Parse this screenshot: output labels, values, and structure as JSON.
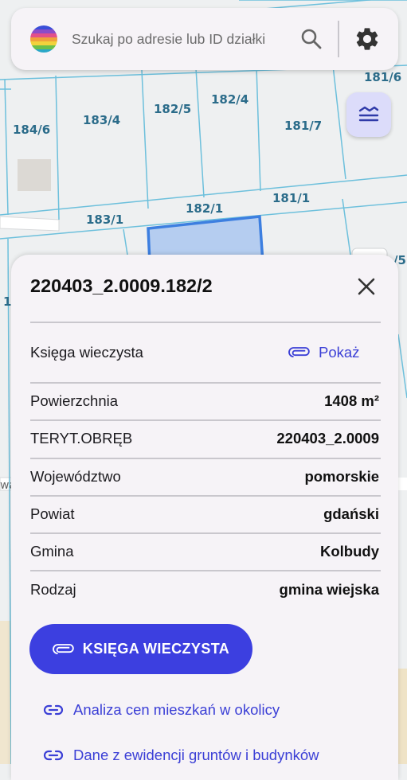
{
  "search": {
    "placeholder": "Szukaj po adresie lub ID działki"
  },
  "map": {
    "parcel_labels": [
      "181/6",
      "184/6",
      "183/4",
      "182/5",
      "182/4",
      "181/7",
      "183/1",
      "182/1",
      "181/1",
      "/5",
      "1",
      "wa"
    ],
    "highlight_color": "#3d7fe0",
    "parcel_line_color": "#6dc0dc"
  },
  "panel": {
    "title": "220403_2.0009.182/2",
    "land_register": {
      "label": "Księga wieczysta",
      "link": "Pokaż"
    },
    "rows": [
      {
        "label": "Powierzchnia",
        "value": "1408 m²"
      },
      {
        "label": "TERYT.OBRĘB",
        "value": "220403_2.0009"
      },
      {
        "label": "Województwo",
        "value": "pomorskie"
      },
      {
        "label": "Powiat",
        "value": "gdański"
      },
      {
        "label": "Gmina",
        "value": "Kolbudy"
      },
      {
        "label": "Rodzaj",
        "value": "gmina wiejska"
      }
    ],
    "primary_button": "KSIĘGA WIECZYSTA",
    "links": [
      "Analiza cen mieszkań w okolicy",
      "Dane z ewidencji gruntów i budynków"
    ]
  },
  "icons": {
    "logo": "app-logo-icon",
    "search": "search-icon",
    "settings": "gear-icon",
    "layers": "layers-icon",
    "close": "close-icon",
    "attachment": "paperclip-icon",
    "link": "link-icon"
  },
  "colors": {
    "accent": "#3c3fe0",
    "link": "#3b3fd6",
    "panel_bg": "#f6f3f7",
    "layers_bg": "#dcdcfa"
  }
}
